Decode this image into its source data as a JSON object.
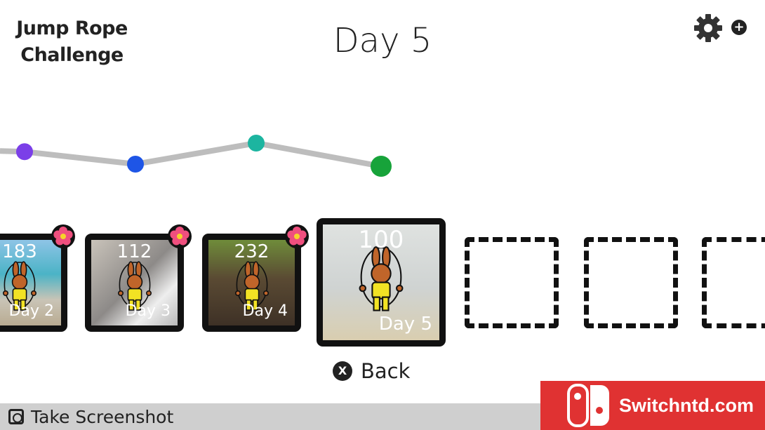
{
  "logo": {
    "line1": "Jump Rope",
    "line2": "Challenge"
  },
  "header": {
    "title": "Day 5",
    "settings_icon": "gear-icon",
    "add_icon": "plus-circle-icon"
  },
  "chart_data": {
    "type": "line",
    "categories": [
      "Day 2",
      "Day 3",
      "Day 4",
      "Day 5"
    ],
    "values": [
      183,
      112,
      232,
      100
    ],
    "colors": [
      "#7b3fe8",
      "#1e55e6",
      "#1cb5a0",
      "#17a33a"
    ],
    "line_color": "#bdbdbd"
  },
  "tiles": [
    {
      "count": "183",
      "day": "Day 2",
      "bg": "linear-gradient(180deg,#8ec4e6 0%,#4bb3c6 40%,#c9c4b6 70%,#b9ab92 100%)",
      "flower": true
    },
    {
      "count": "112",
      "day": "Day 3",
      "bg": "linear-gradient(135deg,#c9c3ba 0%,#8d8a88 50%,#eeeeee 75%,#b8b8b8 100%)",
      "flower": true
    },
    {
      "count": "232",
      "day": "Day 4",
      "bg": "linear-gradient(180deg,#6f8c3a 0%,#5a4a33 45%,#3e3126 100%)",
      "flower": true
    },
    {
      "count": "100",
      "day": "Day 5",
      "bg": "linear-gradient(180deg,#dfe2e0 0%,#cfd3d2 55%,#d9ceb0 100%)",
      "flower": false,
      "selected": true
    }
  ],
  "back": {
    "button": "X",
    "label": "Back"
  },
  "footer": {
    "label": "Take Screenshot"
  },
  "watermark": {
    "text": "Switchntd.com"
  }
}
